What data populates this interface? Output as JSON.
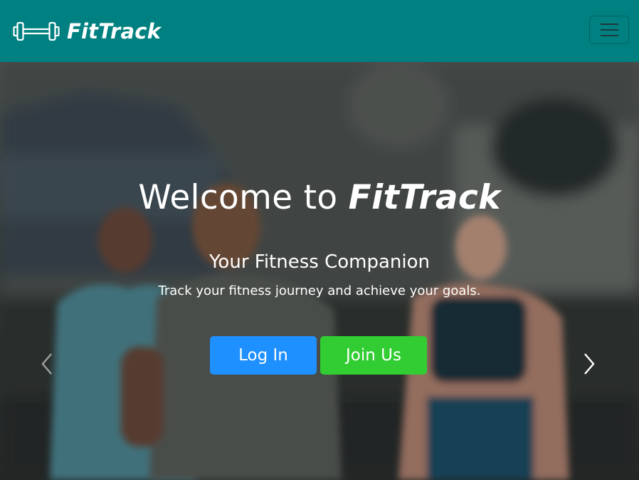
{
  "navbar": {
    "brand_name": "FitTrack",
    "brand_icon": "dumbbell-icon",
    "toggler_icon": "hamburger-menu-icon",
    "background": "#008080"
  },
  "hero": {
    "title_prefix": "Welcome to ",
    "title_brand": "FitTrack",
    "subtitle": "Your Fitness Companion",
    "description": "Track your fitness journey and achieve your goals.",
    "login_label": "Log In",
    "join_label": "Join Us",
    "login_color": "#1e90ff",
    "join_color": "#32cd32",
    "prev_icon": "chevron-left-icon",
    "next_icon": "chevron-right-icon"
  }
}
